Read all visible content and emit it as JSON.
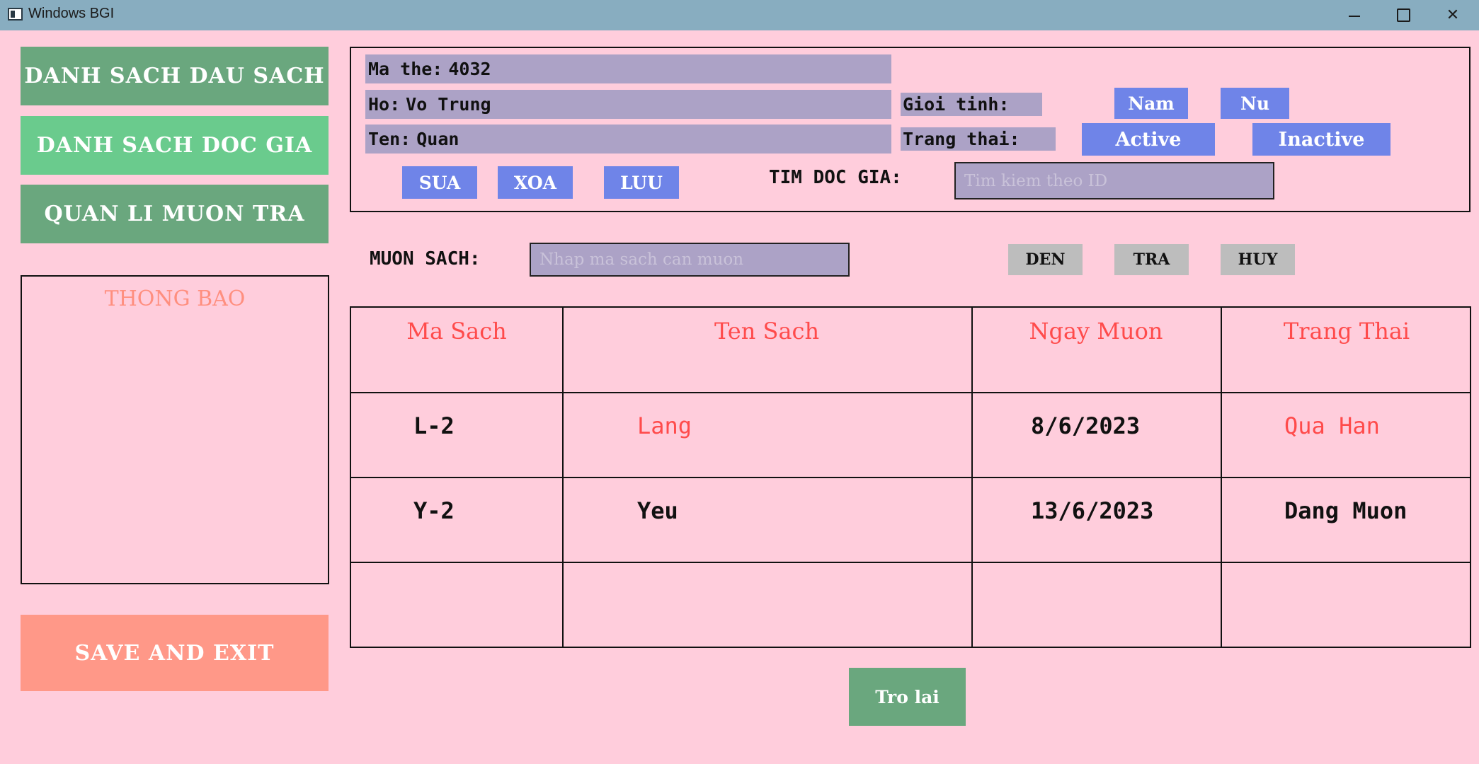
{
  "window": {
    "title": "Windows BGI",
    "minimize_glyph": "",
    "maximize_glyph": "",
    "close_glyph": "✕"
  },
  "sidebar": {
    "items": [
      {
        "label": "DANH SACH DAU SACH"
      },
      {
        "label": "DANH SACH DOC GIA"
      },
      {
        "label": "QUAN LI MUON TRA"
      }
    ],
    "notice_title": "THONG BAO",
    "save_exit_label": "SAVE AND EXIT"
  },
  "reader": {
    "ma_the_label": "Ma the:",
    "ma_the_value": "4032",
    "ho_label": "Ho:",
    "ho_value": "Vo Trung",
    "ten_label": "Ten:",
    "ten_value": "Quan",
    "gioi_tinh_label": "Gioi tinh:",
    "gender_options": [
      "Nam",
      "Nu"
    ],
    "trang_thai_label": "Trang thai:",
    "status_options": [
      "Active",
      "Inactive"
    ],
    "actions": [
      "SUA",
      "XOA",
      "LUU"
    ],
    "search_label": "TIM DOC GIA:",
    "search_placeholder": "Tim kiem theo ID"
  },
  "borrow": {
    "label": "MUON SACH:",
    "placeholder": "Nhap ma sach can muon",
    "actions": [
      "DEN",
      "TRA",
      "HUY"
    ]
  },
  "table": {
    "headers": [
      "Ma Sach",
      "Ten Sach",
      "Ngay Muon",
      "Trang Thai"
    ],
    "rows": [
      {
        "ma_sach": "L-2",
        "ten_sach": "Lang",
        "ngay_muon": "8/6/2023",
        "trang_thai": "Qua Han"
      },
      {
        "ma_sach": "Y-2",
        "ten_sach": "Yeu",
        "ngay_muon": "13/6/2023",
        "trang_thai": "Dang Muon"
      }
    ]
  },
  "back_label": "Tro lai",
  "colors": {
    "background": "#ffcddc",
    "nav_dark": "#6aa77e",
    "nav_active": "#6acb8d",
    "field": "#aca2c6",
    "blue_button": "#6f84e8",
    "gray_button": "#bdbdbd",
    "save_exit": "#ff9888",
    "header_red": "#ff4b4b"
  }
}
